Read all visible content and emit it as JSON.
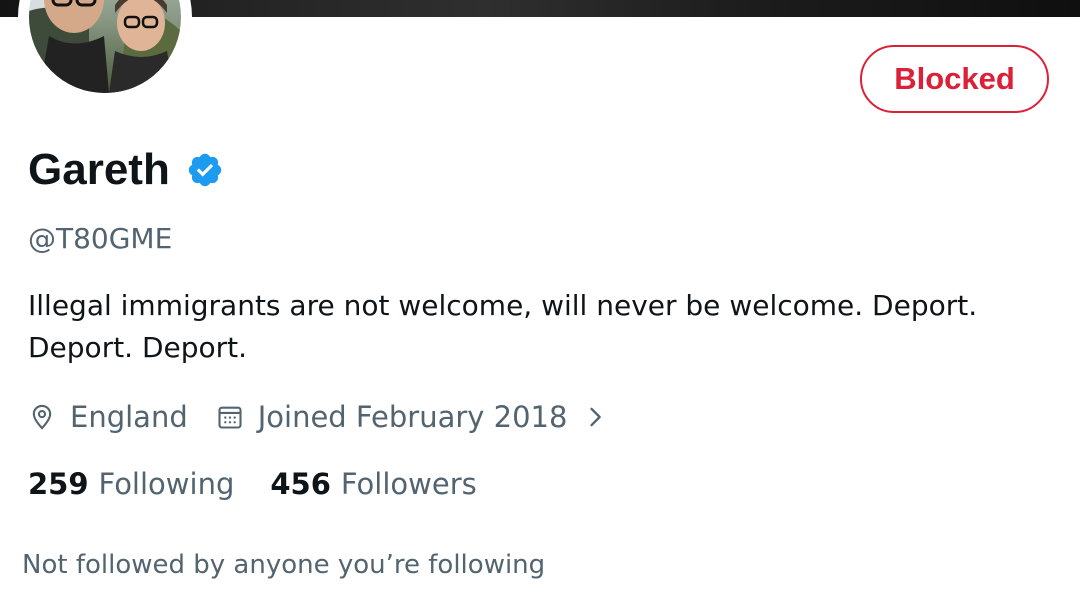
{
  "profile": {
    "blocked_label": "Blocked",
    "display_name": "Gareth",
    "handle": "@T80GME",
    "bio": "Illegal immigrants are not welcome, will never be welcome. Deport. Deport. Deport.",
    "location": "England",
    "joined": "Joined February 2018",
    "following_count": "259",
    "following_label": "Following",
    "followers_count": "456",
    "followers_label": "Followers",
    "followed_by_note": "Not followed by anyone you’re following"
  },
  "icons": {
    "verified": "verified-badge-icon",
    "location": "location-pin-icon",
    "calendar": "calendar-icon",
    "chevron": "chevron-right-icon"
  },
  "colors": {
    "blocked_red": "#dc2037",
    "verified_blue": "#1d9bf0",
    "text_primary": "#0f1419",
    "text_secondary": "#536471"
  }
}
